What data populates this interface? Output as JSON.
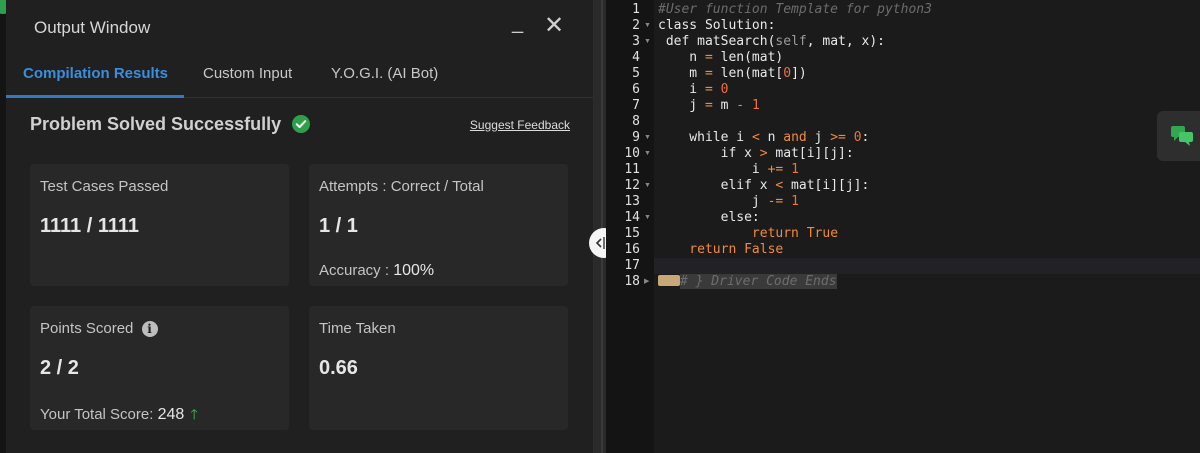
{
  "output_window": {
    "title": "Output Window",
    "minimize": "_",
    "close": "✕",
    "tabs": [
      {
        "label": "Compilation Results",
        "active": true
      },
      {
        "label": "Custom Input",
        "active": false
      },
      {
        "label": "Y.O.G.I. (AI Bot)",
        "active": false
      }
    ],
    "status": "Problem Solved Successfully",
    "feedback_link": "Suggest Feedback",
    "cards": {
      "test_cases": {
        "label": "Test Cases Passed",
        "value": "1111 / 1111"
      },
      "attempts": {
        "label": "Attempts : Correct / Total",
        "value": "1 / 1",
        "sub_label": "Accuracy :",
        "sub_value": "100%"
      },
      "points": {
        "label": "Points Scored",
        "value": "2 / 2",
        "sub_label": "Your Total Score:",
        "sub_value": "248"
      },
      "time": {
        "label": "Time Taken",
        "value": "0.66"
      }
    }
  },
  "editor": {
    "line_numbers": [
      "1",
      "2",
      "3",
      "4",
      "5",
      "6",
      "7",
      "8",
      "9",
      "10",
      "11",
      "12",
      "13",
      "14",
      "15",
      "16",
      "17",
      "18"
    ],
    "folded_text": "# } Driver Code Ends",
    "code_lines": [
      [
        {
          "t": "#User function Template for python3",
          "c": "c-com"
        }
      ],
      [
        {
          "t": "class ",
          "c": "c-txt"
        },
        {
          "t": "Solution:",
          "c": "c-txt"
        }
      ],
      [
        {
          "t": " def ",
          "c": "c-txt"
        },
        {
          "t": "matSearch(",
          "c": "c-txt"
        },
        {
          "t": "self",
          "c": "c-self"
        },
        {
          "t": ", mat, x):",
          "c": "c-txt"
        }
      ],
      [
        {
          "t": "    n ",
          "c": "c-txt"
        },
        {
          "t": "=",
          "c": "c-op"
        },
        {
          "t": " len(mat)",
          "c": "c-txt"
        }
      ],
      [
        {
          "t": "    m ",
          "c": "c-txt"
        },
        {
          "t": "=",
          "c": "c-op"
        },
        {
          "t": " len(mat[",
          "c": "c-txt"
        },
        {
          "t": "0",
          "c": "c-num"
        },
        {
          "t": "])",
          "c": "c-txt"
        }
      ],
      [
        {
          "t": "    i ",
          "c": "c-txt"
        },
        {
          "t": "=",
          "c": "c-op"
        },
        {
          "t": " ",
          "c": "c-txt"
        },
        {
          "t": "0",
          "c": "c-num"
        }
      ],
      [
        {
          "t": "    j ",
          "c": "c-txt"
        },
        {
          "t": "=",
          "c": "c-op"
        },
        {
          "t": " m ",
          "c": "c-txt"
        },
        {
          "t": "-",
          "c": "c-op"
        },
        {
          "t": " ",
          "c": "c-txt"
        },
        {
          "t": "1",
          "c": "c-num"
        }
      ],
      [
        {
          "t": "",
          "c": "c-txt"
        }
      ],
      [
        {
          "t": "    while ",
          "c": "c-txt"
        },
        {
          "t": "i ",
          "c": "c-txt"
        },
        {
          "t": "<",
          "c": "c-op"
        },
        {
          "t": " n ",
          "c": "c-txt"
        },
        {
          "t": "and",
          "c": "c-kw"
        },
        {
          "t": " j ",
          "c": "c-txt"
        },
        {
          "t": ">=",
          "c": "c-op"
        },
        {
          "t": " ",
          "c": "c-txt"
        },
        {
          "t": "0",
          "c": "c-num"
        },
        {
          "t": ":",
          "c": "c-txt"
        }
      ],
      [
        {
          "t": "        if ",
          "c": "c-txt"
        },
        {
          "t": "x ",
          "c": "c-txt"
        },
        {
          "t": ">",
          "c": "c-op"
        },
        {
          "t": " mat[i][j]:",
          "c": "c-txt"
        }
      ],
      [
        {
          "t": "            i ",
          "c": "c-txt"
        },
        {
          "t": "+=",
          "c": "c-op"
        },
        {
          "t": " ",
          "c": "c-txt"
        },
        {
          "t": "1",
          "c": "c-num"
        }
      ],
      [
        {
          "t": "        elif ",
          "c": "c-txt"
        },
        {
          "t": "x ",
          "c": "c-txt"
        },
        {
          "t": "<",
          "c": "c-op"
        },
        {
          "t": " mat[i][j]:",
          "c": "c-txt"
        }
      ],
      [
        {
          "t": "            j ",
          "c": "c-txt"
        },
        {
          "t": "-=",
          "c": "c-op"
        },
        {
          "t": " ",
          "c": "c-txt"
        },
        {
          "t": "1",
          "c": "c-num"
        }
      ],
      [
        {
          "t": "        else:",
          "c": "c-txt"
        }
      ],
      [
        {
          "t": "            return ",
          "c": "c-kw"
        },
        {
          "t": "True",
          "c": "c-kw"
        }
      ],
      [
        {
          "t": "    return ",
          "c": "c-kw"
        },
        {
          "t": "False",
          "c": "c-kw"
        }
      ],
      [
        {
          "t": "",
          "c": "c-txt"
        }
      ],
      [
        {
          "t": "",
          "c": "c-txt"
        }
      ]
    ],
    "fold_markers": [
      "",
      "▼",
      "▼",
      "",
      "",
      "",
      "",
      "",
      "▼",
      "▼",
      "",
      "▼",
      "",
      "▼",
      "",
      "",
      "",
      "▶"
    ]
  },
  "colors": {
    "accent": "#3b8ddd",
    "success": "#3bbf5a",
    "keyword": "#f28b3b"
  },
  "icons": {
    "check": "check-circle-icon",
    "info": "info-icon",
    "arrow": "arrow-up-icon",
    "chat": "chat-icon",
    "splitter": "resize-handle-icon"
  }
}
